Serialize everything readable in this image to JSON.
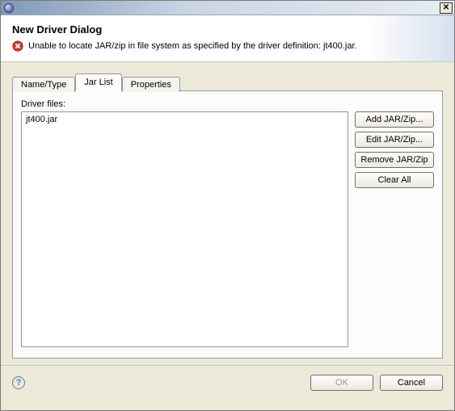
{
  "titlebar": {
    "close_glyph": "✕"
  },
  "header": {
    "title": "New Driver Dialog",
    "error_message": "Unable to locate JAR/zip in file system as specified by the driver definition: jt400.jar."
  },
  "tabs": {
    "items": [
      {
        "label": "Name/Type",
        "active": false
      },
      {
        "label": "Jar List",
        "active": true
      },
      {
        "label": "Properties",
        "active": false
      }
    ]
  },
  "panel": {
    "list_label": "Driver files:",
    "files": [
      "jt400.jar"
    ],
    "buttons": {
      "add": "Add JAR/Zip...",
      "edit": "Edit JAR/Zip...",
      "remove": "Remove JAR/Zip",
      "clear": "Clear All"
    }
  },
  "footer": {
    "help_glyph": "?",
    "ok": "OK",
    "cancel": "Cancel"
  }
}
